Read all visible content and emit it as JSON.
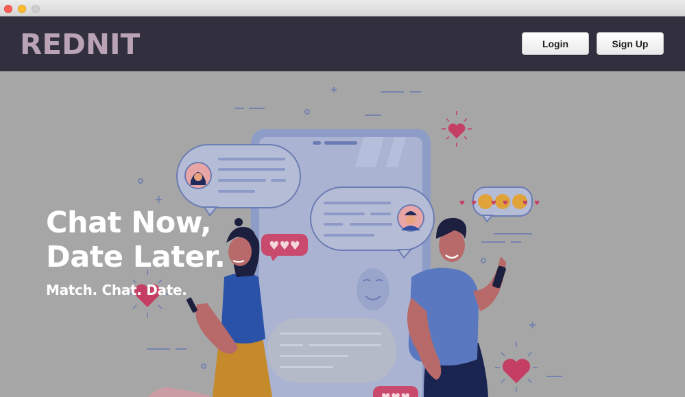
{
  "window": {
    "controls": [
      "close",
      "minimize",
      "zoom"
    ]
  },
  "navbar": {
    "brand": "REDNIT",
    "login_label": "Login",
    "signup_label": "Sign Up"
  },
  "hero": {
    "headline_line1": "Chat Now,",
    "headline_line2": "Date Later.",
    "tagline": "Match. Chat. Date.",
    "illustration": "two-people-chatting-on-phones",
    "overlay_color": "#a6a6a6"
  },
  "colors": {
    "navbar_bg": "#322f3e",
    "brand": "#b9a3b5",
    "heart": "#c43f63",
    "accent_blue": "#5a78c0"
  }
}
